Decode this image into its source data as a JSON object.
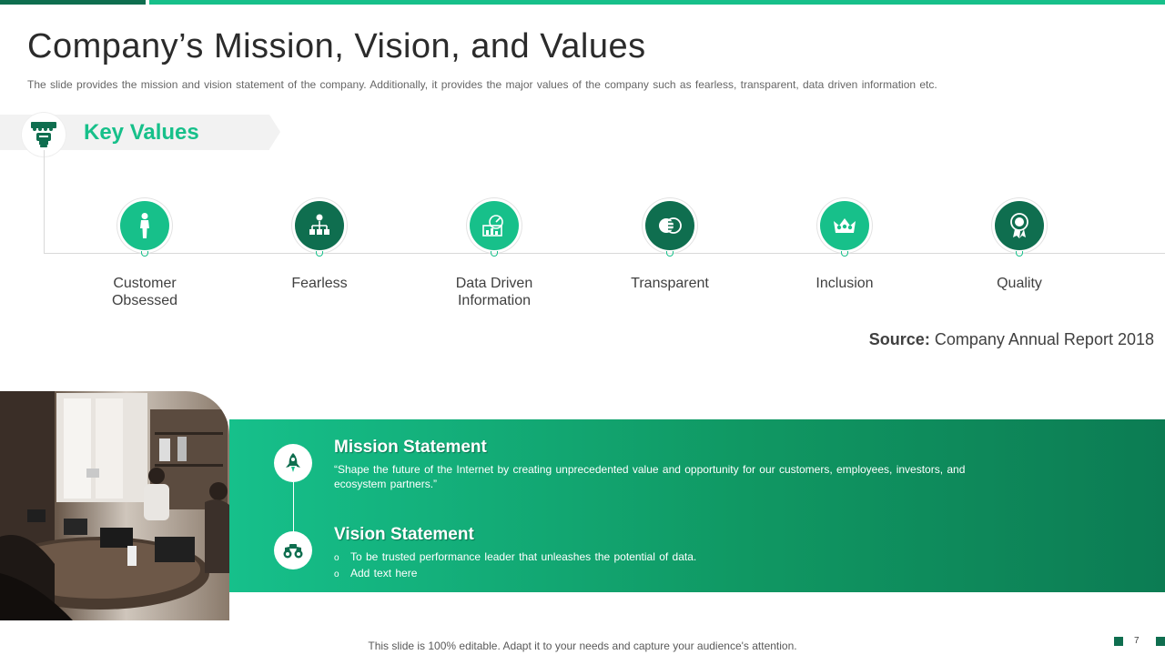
{
  "slide": {
    "title": "Company’s Mission, Vision, and Values",
    "subtitle": "The slide provides  the mission and vision statement of the company. Additionally, it provides the major values  of the company such as fearless, transparent, data driven  information  etc.",
    "key_values_title": "Key Values",
    "values": [
      {
        "label": "Customer\nObsessed",
        "icon": "person-icon",
        "style": "light"
      },
      {
        "label": "Fearless",
        "icon": "hierarchy-icon",
        "style": "dark"
      },
      {
        "label": "Data Driven\nInformation",
        "icon": "data-chart-icon",
        "style": "light"
      },
      {
        "label": "Transparent",
        "icon": "overlap-circles-icon",
        "style": "dark"
      },
      {
        "label": "Inclusion",
        "icon": "group-crown-icon",
        "style": "light"
      },
      {
        "label": "Quality",
        "icon": "award-badge-icon",
        "style": "dark"
      }
    ],
    "source_label": "Source:",
    "source_text": " Company Annual Report 2018",
    "mission_title": "Mission Statement",
    "mission_text": "“Shape the future of the Internet  by creating unprecedented  value  and opportunity for our customers, employees, investors, and ecosystem partners.”",
    "vision_title": "Vision Statement",
    "vision_bullets": [
      "To be trusted performance  leader that unleashes the potential of data.",
      "Add text here"
    ],
    "bullet_symbol": "o",
    "footer": "This slide is 100% editable. Adapt it to your needs and capture your audience's attention.",
    "page_number": "7"
  },
  "colors": {
    "accent_light": "#17c08a",
    "accent_dark": "#0f6e4f"
  }
}
